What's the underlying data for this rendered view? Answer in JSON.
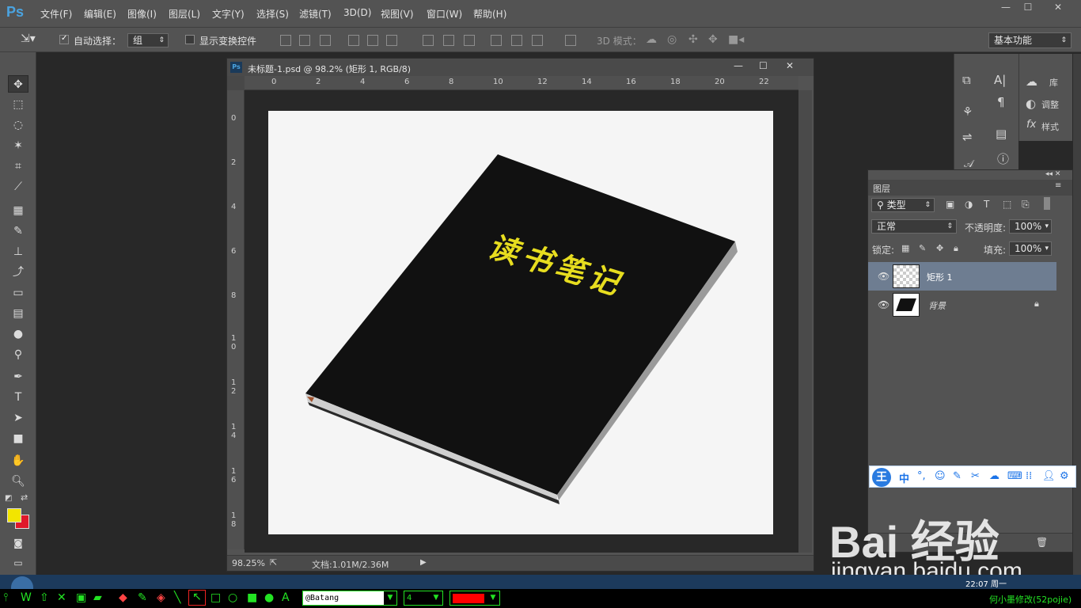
{
  "app": {
    "logo": "Ps"
  },
  "menu": [
    "文件(F)",
    "编辑(E)",
    "图像(I)",
    "图层(L)",
    "文字(Y)",
    "选择(S)",
    "滤镜(T)",
    "3D(D)",
    "视图(V)",
    "窗口(W)",
    "帮助(H)"
  ],
  "window_controls": {
    "minimize": "—",
    "maximize": "☐",
    "close": "✕"
  },
  "options": {
    "auto_select_label": "自动选择：",
    "auto_select_value": "组",
    "show_transform_label": "显示变换控件",
    "mode_3d_label": "3D 模式：",
    "workspace": "基本功能"
  },
  "document": {
    "title": "未标题-1.psd @ 98.2% (矩形 1, RGB/8)",
    "ruler_h": [
      "0",
      "2",
      "4",
      "6",
      "8",
      "10",
      "12",
      "14",
      "16",
      "18",
      "20",
      "22"
    ],
    "ruler_v": [
      "0",
      "2",
      "4",
      "6",
      "8",
      "10",
      "12",
      "14",
      "16",
      "18"
    ],
    "zoom": "98.25%",
    "doc_size": "文档:1.01M/2.36M",
    "book_text": "读书笔记"
  },
  "panels": {
    "library": "库",
    "adjust": "调整",
    "styles": "样式",
    "layers_tab": "图层",
    "filter_type": "类型",
    "blend_mode": "正常",
    "opacity_label": "不透明度:",
    "opacity_value": "100%",
    "lock_label": "锁定:",
    "fill_label": "填充:",
    "fill_value": "100%",
    "layers": [
      {
        "name": "矩形 1",
        "selected": true
      },
      {
        "name": "背景",
        "selected": false
      }
    ]
  },
  "ime": {
    "logo": "王",
    "lang": "中"
  },
  "watermark": {
    "brand": "Bai 经验",
    "url": "jingyan.baidu.com"
  },
  "taskbar": {
    "clock": "22:07 周一"
  },
  "draw_toolbar": {
    "font": "@Batang",
    "size": "4",
    "credit": "何小墨修改(52pojie)"
  },
  "colors": {
    "foreground": "#f2e500",
    "background": "#e0182a",
    "accent": "#4aa3e0",
    "book_title": "#e7dd1f"
  }
}
